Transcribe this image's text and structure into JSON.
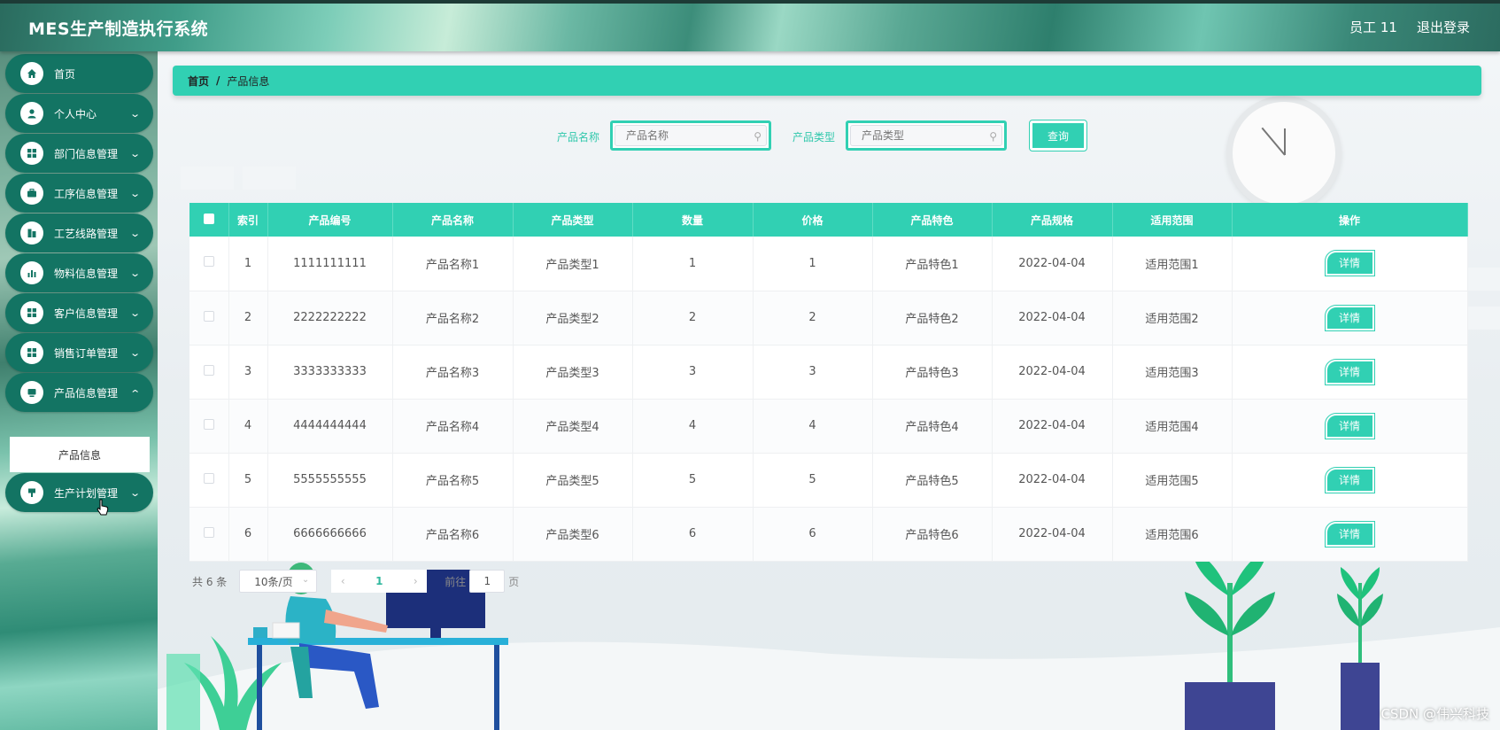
{
  "header": {
    "title": "MES生产制造执行系统",
    "user": "员工 11",
    "logout": "退出登录"
  },
  "sidebar": {
    "items": [
      {
        "label": "首页",
        "icon": "home-icon",
        "expandable": false
      },
      {
        "label": "个人中心",
        "icon": "user-icon",
        "expandable": true
      },
      {
        "label": "部门信息管理",
        "icon": "grid-icon",
        "expandable": true
      },
      {
        "label": "工序信息管理",
        "icon": "briefcase-icon",
        "expandable": true
      },
      {
        "label": "工艺线路管理",
        "icon": "building-icon",
        "expandable": true
      },
      {
        "label": "物料信息管理",
        "icon": "bar-chart-icon",
        "expandable": true
      },
      {
        "label": "客户信息管理",
        "icon": "grid-icon",
        "expandable": true
      },
      {
        "label": "销售订单管理",
        "icon": "grid-icon",
        "expandable": true
      },
      {
        "label": "产品信息管理",
        "icon": "monitor-icon",
        "expandable": true
      },
      {
        "label": "生产计划管理",
        "icon": "plan-icon",
        "expandable": true
      }
    ],
    "submenu": {
      "label": "产品信息"
    }
  },
  "breadcrumb": {
    "home": "首页",
    "separator": "/",
    "current": "产品信息"
  },
  "search": {
    "name_label": "产品名称",
    "name_placeholder": "产品名称",
    "type_label": "产品类型",
    "type_placeholder": "产品类型",
    "query_button": "查询"
  },
  "table": {
    "headers": [
      "索引",
      "产品编号",
      "产品名称",
      "产品类型",
      "数量",
      "价格",
      "产品特色",
      "产品规格",
      "适用范围",
      "操作"
    ],
    "rows": [
      {
        "index": "1",
        "code": "1111111111",
        "name": "产品名称1",
        "type": "产品类型1",
        "qty": "1",
        "price": "1",
        "feature": "产品特色1",
        "spec": "2022-04-04",
        "scope": "适用范围1",
        "action": "详情"
      },
      {
        "index": "2",
        "code": "2222222222",
        "name": "产品名称2",
        "type": "产品类型2",
        "qty": "2",
        "price": "2",
        "feature": "产品特色2",
        "spec": "2022-04-04",
        "scope": "适用范围2",
        "action": "详情"
      },
      {
        "index": "3",
        "code": "3333333333",
        "name": "产品名称3",
        "type": "产品类型3",
        "qty": "3",
        "price": "3",
        "feature": "产品特色3",
        "spec": "2022-04-04",
        "scope": "适用范围3",
        "action": "详情"
      },
      {
        "index": "4",
        "code": "4444444444",
        "name": "产品名称4",
        "type": "产品类型4",
        "qty": "4",
        "price": "4",
        "feature": "产品特色4",
        "spec": "2022-04-04",
        "scope": "适用范围4",
        "action": "详情"
      },
      {
        "index": "5",
        "code": "5555555555",
        "name": "产品名称5",
        "type": "产品类型5",
        "qty": "5",
        "price": "5",
        "feature": "产品特色5",
        "spec": "2022-04-04",
        "scope": "适用范围5",
        "action": "详情"
      },
      {
        "index": "6",
        "code": "6666666666",
        "name": "产品名称6",
        "type": "产品类型6",
        "qty": "6",
        "price": "6",
        "feature": "产品特色6",
        "spec": "2022-04-04",
        "scope": "适用范围6",
        "action": "详情"
      }
    ]
  },
  "pagination": {
    "total": "共 6 条",
    "page_size": "10条/页",
    "current_page": "1",
    "goto_label": "前往",
    "goto_value": "1",
    "page_suffix": "页"
  },
  "watermark": "CSDN @伟兴科技",
  "colors": {
    "accent": "#31d0b3",
    "sidebar_item": "#137463"
  }
}
